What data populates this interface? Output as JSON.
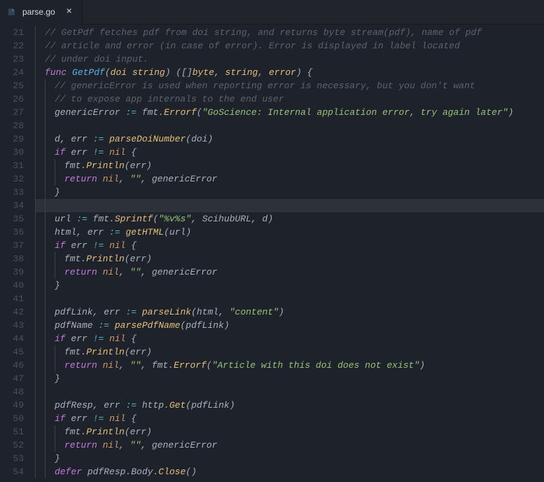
{
  "tab": {
    "filename": "parse.go",
    "icon": "go-file-icon"
  },
  "gutter": {
    "start": 21,
    "end": 54
  },
  "code": {
    "lines": [
      {
        "n": 21,
        "seg": [
          {
            "c": "comment",
            "t": "// GetPdf fetches pdf from doi string, and returns byte stream(pdf), name of pdf"
          }
        ],
        "indent": 1
      },
      {
        "n": 22,
        "seg": [
          {
            "c": "comment",
            "t": "// article and error (in case of error). Error is displayed in label located"
          }
        ],
        "indent": 1
      },
      {
        "n": 23,
        "seg": [
          {
            "c": "comment",
            "t": "// under doi input."
          }
        ],
        "indent": 1
      },
      {
        "n": 24,
        "seg": [
          {
            "c": "keyword",
            "t": "func"
          },
          {
            "c": "punct",
            "t": " "
          },
          {
            "c": "func-name",
            "t": "GetPdf"
          },
          {
            "c": "punct",
            "t": "("
          },
          {
            "c": "param",
            "t": "doi"
          },
          {
            "c": "punct",
            "t": " "
          },
          {
            "c": "type",
            "t": "string"
          },
          {
            "c": "punct",
            "t": ") (["
          },
          {
            "c": "punct",
            "t": "]"
          },
          {
            "c": "type",
            "t": "byte"
          },
          {
            "c": "punct",
            "t": ", "
          },
          {
            "c": "type",
            "t": "string"
          },
          {
            "c": "punct",
            "t": ", "
          },
          {
            "c": "type",
            "t": "error"
          },
          {
            "c": "punct",
            "t": ") {"
          }
        ],
        "indent": 1
      },
      {
        "n": 25,
        "seg": [
          {
            "c": "comment",
            "t": "// genericError is used when reporting error is necessary, but you don't want"
          }
        ],
        "indent": 2
      },
      {
        "n": 26,
        "seg": [
          {
            "c": "comment",
            "t": "// to expose app internals to the end user"
          }
        ],
        "indent": 2
      },
      {
        "n": 27,
        "seg": [
          {
            "c": "ident",
            "t": "genericError "
          },
          {
            "c": "operator",
            "t": ":="
          },
          {
            "c": "ident",
            "t": " fmt"
          },
          {
            "c": "punct",
            "t": "."
          },
          {
            "c": "call",
            "t": "Errorf"
          },
          {
            "c": "punct",
            "t": "("
          },
          {
            "c": "string",
            "t": "\"GoScience: Internal application error, try again later\""
          },
          {
            "c": "punct",
            "t": ")"
          }
        ],
        "indent": 2
      },
      {
        "n": 28,
        "seg": [],
        "indent": 2
      },
      {
        "n": 29,
        "seg": [
          {
            "c": "ident",
            "t": "d"
          },
          {
            "c": "punct",
            "t": ", "
          },
          {
            "c": "ident",
            "t": "err "
          },
          {
            "c": "operator",
            "t": ":="
          },
          {
            "c": "punct",
            "t": " "
          },
          {
            "c": "call",
            "t": "parseDoiNumber"
          },
          {
            "c": "punct",
            "t": "("
          },
          {
            "c": "ident",
            "t": "doi"
          },
          {
            "c": "punct",
            "t": ")"
          }
        ],
        "indent": 2
      },
      {
        "n": 30,
        "seg": [
          {
            "c": "keyword",
            "t": "if"
          },
          {
            "c": "punct",
            "t": " "
          },
          {
            "c": "ident",
            "t": "err "
          },
          {
            "c": "operator",
            "t": "!="
          },
          {
            "c": "punct",
            "t": " "
          },
          {
            "c": "const",
            "t": "nil"
          },
          {
            "c": "punct",
            "t": " {"
          }
        ],
        "indent": 2
      },
      {
        "n": 31,
        "seg": [
          {
            "c": "ident",
            "t": "fmt"
          },
          {
            "c": "punct",
            "t": "."
          },
          {
            "c": "call",
            "t": "Println"
          },
          {
            "c": "punct",
            "t": "("
          },
          {
            "c": "ident",
            "t": "err"
          },
          {
            "c": "punct",
            "t": ")"
          }
        ],
        "indent": 3
      },
      {
        "n": 32,
        "seg": [
          {
            "c": "keyword",
            "t": "return"
          },
          {
            "c": "punct",
            "t": " "
          },
          {
            "c": "const",
            "t": "nil"
          },
          {
            "c": "punct",
            "t": ", "
          },
          {
            "c": "string",
            "t": "\"\""
          },
          {
            "c": "punct",
            "t": ", "
          },
          {
            "c": "ident",
            "t": "genericError"
          }
        ],
        "indent": 3
      },
      {
        "n": 33,
        "seg": [
          {
            "c": "punct",
            "t": "}"
          }
        ],
        "indent": 2
      },
      {
        "n": 34,
        "seg": [],
        "indent": 2,
        "hl": true
      },
      {
        "n": 35,
        "seg": [
          {
            "c": "ident",
            "t": "url "
          },
          {
            "c": "operator",
            "t": ":="
          },
          {
            "c": "ident",
            "t": " fmt"
          },
          {
            "c": "punct",
            "t": "."
          },
          {
            "c": "call",
            "t": "Sprintf"
          },
          {
            "c": "punct",
            "t": "("
          },
          {
            "c": "string",
            "t": "\"%v%s\""
          },
          {
            "c": "punct",
            "t": ", "
          },
          {
            "c": "ident",
            "t": "ScihubURL"
          },
          {
            "c": "punct",
            "t": ", "
          },
          {
            "c": "ident",
            "t": "d"
          },
          {
            "c": "punct",
            "t": ")"
          }
        ],
        "indent": 2
      },
      {
        "n": 36,
        "seg": [
          {
            "c": "ident",
            "t": "html"
          },
          {
            "c": "punct",
            "t": ", "
          },
          {
            "c": "ident",
            "t": "err "
          },
          {
            "c": "operator",
            "t": ":="
          },
          {
            "c": "punct",
            "t": " "
          },
          {
            "c": "call",
            "t": "getHTML"
          },
          {
            "c": "punct",
            "t": "("
          },
          {
            "c": "ident",
            "t": "url"
          },
          {
            "c": "punct",
            "t": ")"
          }
        ],
        "indent": 2
      },
      {
        "n": 37,
        "seg": [
          {
            "c": "keyword",
            "t": "if"
          },
          {
            "c": "punct",
            "t": " "
          },
          {
            "c": "ident",
            "t": "err "
          },
          {
            "c": "operator",
            "t": "!="
          },
          {
            "c": "punct",
            "t": " "
          },
          {
            "c": "const",
            "t": "nil"
          },
          {
            "c": "punct",
            "t": " {"
          }
        ],
        "indent": 2
      },
      {
        "n": 38,
        "seg": [
          {
            "c": "ident",
            "t": "fmt"
          },
          {
            "c": "punct",
            "t": "."
          },
          {
            "c": "call",
            "t": "Println"
          },
          {
            "c": "punct",
            "t": "("
          },
          {
            "c": "ident",
            "t": "err"
          },
          {
            "c": "punct",
            "t": ")"
          }
        ],
        "indent": 3
      },
      {
        "n": 39,
        "seg": [
          {
            "c": "keyword",
            "t": "return"
          },
          {
            "c": "punct",
            "t": " "
          },
          {
            "c": "const",
            "t": "nil"
          },
          {
            "c": "punct",
            "t": ", "
          },
          {
            "c": "string",
            "t": "\"\""
          },
          {
            "c": "punct",
            "t": ", "
          },
          {
            "c": "ident",
            "t": "genericError"
          }
        ],
        "indent": 3
      },
      {
        "n": 40,
        "seg": [
          {
            "c": "punct",
            "t": "}"
          }
        ],
        "indent": 2
      },
      {
        "n": 41,
        "seg": [],
        "indent": 2
      },
      {
        "n": 42,
        "seg": [
          {
            "c": "ident",
            "t": "pdfLink"
          },
          {
            "c": "punct",
            "t": ", "
          },
          {
            "c": "ident",
            "t": "err "
          },
          {
            "c": "operator",
            "t": ":="
          },
          {
            "c": "punct",
            "t": " "
          },
          {
            "c": "call",
            "t": "parseLink"
          },
          {
            "c": "punct",
            "t": "("
          },
          {
            "c": "ident",
            "t": "html"
          },
          {
            "c": "punct",
            "t": ", "
          },
          {
            "c": "string",
            "t": "\"content\""
          },
          {
            "c": "punct",
            "t": ")"
          }
        ],
        "indent": 2
      },
      {
        "n": 43,
        "seg": [
          {
            "c": "ident",
            "t": "pdfName "
          },
          {
            "c": "operator",
            "t": ":="
          },
          {
            "c": "punct",
            "t": " "
          },
          {
            "c": "call",
            "t": "parsePdfName"
          },
          {
            "c": "punct",
            "t": "("
          },
          {
            "c": "ident",
            "t": "pdfLink"
          },
          {
            "c": "punct",
            "t": ")"
          }
        ],
        "indent": 2
      },
      {
        "n": 44,
        "seg": [
          {
            "c": "keyword",
            "t": "if"
          },
          {
            "c": "punct",
            "t": " "
          },
          {
            "c": "ident",
            "t": "err "
          },
          {
            "c": "operator",
            "t": "!="
          },
          {
            "c": "punct",
            "t": " "
          },
          {
            "c": "const",
            "t": "nil"
          },
          {
            "c": "punct",
            "t": " {"
          }
        ],
        "indent": 2
      },
      {
        "n": 45,
        "seg": [
          {
            "c": "ident",
            "t": "fmt"
          },
          {
            "c": "punct",
            "t": "."
          },
          {
            "c": "call",
            "t": "Println"
          },
          {
            "c": "punct",
            "t": "("
          },
          {
            "c": "ident",
            "t": "err"
          },
          {
            "c": "punct",
            "t": ")"
          }
        ],
        "indent": 3
      },
      {
        "n": 46,
        "seg": [
          {
            "c": "keyword",
            "t": "return"
          },
          {
            "c": "punct",
            "t": " "
          },
          {
            "c": "const",
            "t": "nil"
          },
          {
            "c": "punct",
            "t": ", "
          },
          {
            "c": "string",
            "t": "\"\""
          },
          {
            "c": "punct",
            "t": ", "
          },
          {
            "c": "ident",
            "t": "fmt"
          },
          {
            "c": "punct",
            "t": "."
          },
          {
            "c": "call",
            "t": "Errorf"
          },
          {
            "c": "punct",
            "t": "("
          },
          {
            "c": "string",
            "t": "\"Article with this doi does not exist\""
          },
          {
            "c": "punct",
            "t": ")"
          }
        ],
        "indent": 3
      },
      {
        "n": 47,
        "seg": [
          {
            "c": "punct",
            "t": "}"
          }
        ],
        "indent": 2
      },
      {
        "n": 48,
        "seg": [],
        "indent": 2
      },
      {
        "n": 49,
        "seg": [
          {
            "c": "ident",
            "t": "pdfResp"
          },
          {
            "c": "punct",
            "t": ", "
          },
          {
            "c": "ident",
            "t": "err "
          },
          {
            "c": "operator",
            "t": ":="
          },
          {
            "c": "ident",
            "t": " http"
          },
          {
            "c": "punct",
            "t": "."
          },
          {
            "c": "call",
            "t": "Get"
          },
          {
            "c": "punct",
            "t": "("
          },
          {
            "c": "ident",
            "t": "pdfLink"
          },
          {
            "c": "punct",
            "t": ")"
          }
        ],
        "indent": 2
      },
      {
        "n": 50,
        "seg": [
          {
            "c": "keyword",
            "t": "if"
          },
          {
            "c": "punct",
            "t": " "
          },
          {
            "c": "ident",
            "t": "err "
          },
          {
            "c": "operator",
            "t": "!="
          },
          {
            "c": "punct",
            "t": " "
          },
          {
            "c": "const",
            "t": "nil"
          },
          {
            "c": "punct",
            "t": " {"
          }
        ],
        "indent": 2
      },
      {
        "n": 51,
        "seg": [
          {
            "c": "ident",
            "t": "fmt"
          },
          {
            "c": "punct",
            "t": "."
          },
          {
            "c": "call",
            "t": "Println"
          },
          {
            "c": "punct",
            "t": "("
          },
          {
            "c": "ident",
            "t": "err"
          },
          {
            "c": "punct",
            "t": ")"
          }
        ],
        "indent": 3
      },
      {
        "n": 52,
        "seg": [
          {
            "c": "keyword",
            "t": "return"
          },
          {
            "c": "punct",
            "t": " "
          },
          {
            "c": "const",
            "t": "nil"
          },
          {
            "c": "punct",
            "t": ", "
          },
          {
            "c": "string",
            "t": "\"\""
          },
          {
            "c": "punct",
            "t": ", "
          },
          {
            "c": "ident",
            "t": "genericError"
          }
        ],
        "indent": 3
      },
      {
        "n": 53,
        "seg": [
          {
            "c": "punct",
            "t": "}"
          }
        ],
        "indent": 2
      },
      {
        "n": 54,
        "seg": [
          {
            "c": "keyword",
            "t": "defer"
          },
          {
            "c": "ident",
            "t": " pdfResp"
          },
          {
            "c": "punct",
            "t": "."
          },
          {
            "c": "ident",
            "t": "Body"
          },
          {
            "c": "punct",
            "t": "."
          },
          {
            "c": "call",
            "t": "Close"
          },
          {
            "c": "punct",
            "t": "()"
          }
        ],
        "indent": 2
      }
    ]
  }
}
